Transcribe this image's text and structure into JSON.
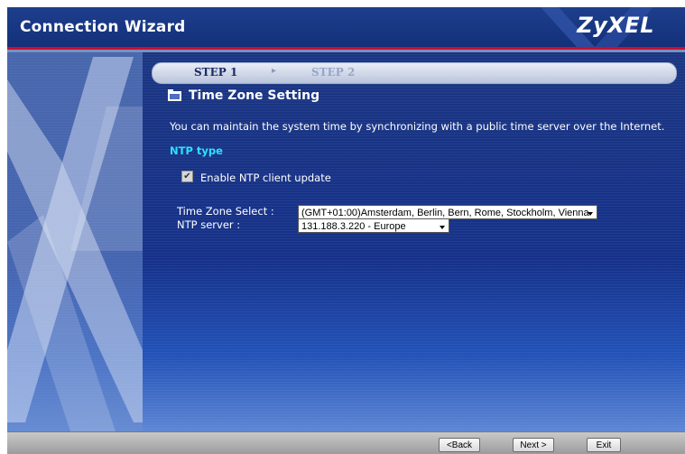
{
  "header": {
    "title": "Connection Wizard",
    "logo": "ZyXEL"
  },
  "steps": {
    "step1": "STEP 1",
    "step2": "STEP 2",
    "active": "STEP 1"
  },
  "section": {
    "title": "Time Zone Setting",
    "icon": "folder-icon"
  },
  "description": "You can maintain the system time by synchronizing with a public time server over the Internet.",
  "ntp": {
    "heading": "NTP type",
    "enable_label": "Enable NTP client update",
    "enable_checked": true,
    "time_zone_label": "Time Zone Select :",
    "time_zone_value": "(GMT+01:00)Amsterdam, Berlin, Bern, Rome, Stockholm, Vienna",
    "server_label": "NTP server :",
    "server_value": "131.188.3.220 - Europe"
  },
  "footer": {
    "back": "<Back",
    "next": "Next >",
    "exit": "Exit"
  },
  "colors": {
    "header_bg": "#1e3e8c",
    "accent_red": "#c8102e",
    "ntp_heading": "#2ee0ff",
    "main_bg": "#1b3682"
  }
}
